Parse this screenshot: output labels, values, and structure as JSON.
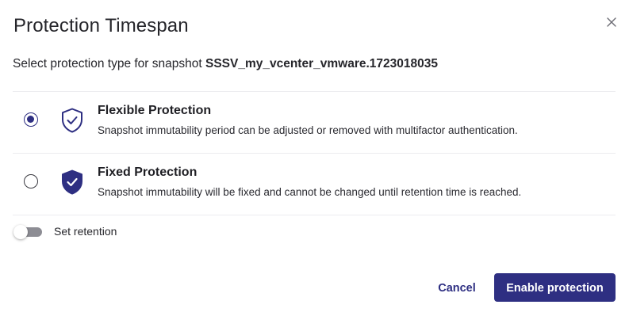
{
  "dialog": {
    "title": "Protection Timespan",
    "close_icon": "close-icon",
    "subtitle_prefix": "Select protection type for snapshot ",
    "snapshot_name": "SSSV_my_vcenter_vmware.1723018035"
  },
  "options": [
    {
      "title": "Flexible Protection",
      "description": "Snapshot immutability period can be adjusted or removed with multifactor authentication.",
      "selected": true,
      "icon": "shield-check-outline-icon"
    },
    {
      "title": "Fixed Protection",
      "description": "Snapshot immutability will be fixed and cannot be changed until retention time is reached.",
      "selected": false,
      "icon": "shield-check-filled-icon"
    }
  ],
  "retention": {
    "label": "Set retention",
    "enabled": false
  },
  "footer": {
    "cancel_label": "Cancel",
    "primary_label": "Enable protection"
  },
  "colors": {
    "accent": "#2e2f82",
    "divider": "#ececef",
    "toggle_track": "#8d8d94"
  }
}
